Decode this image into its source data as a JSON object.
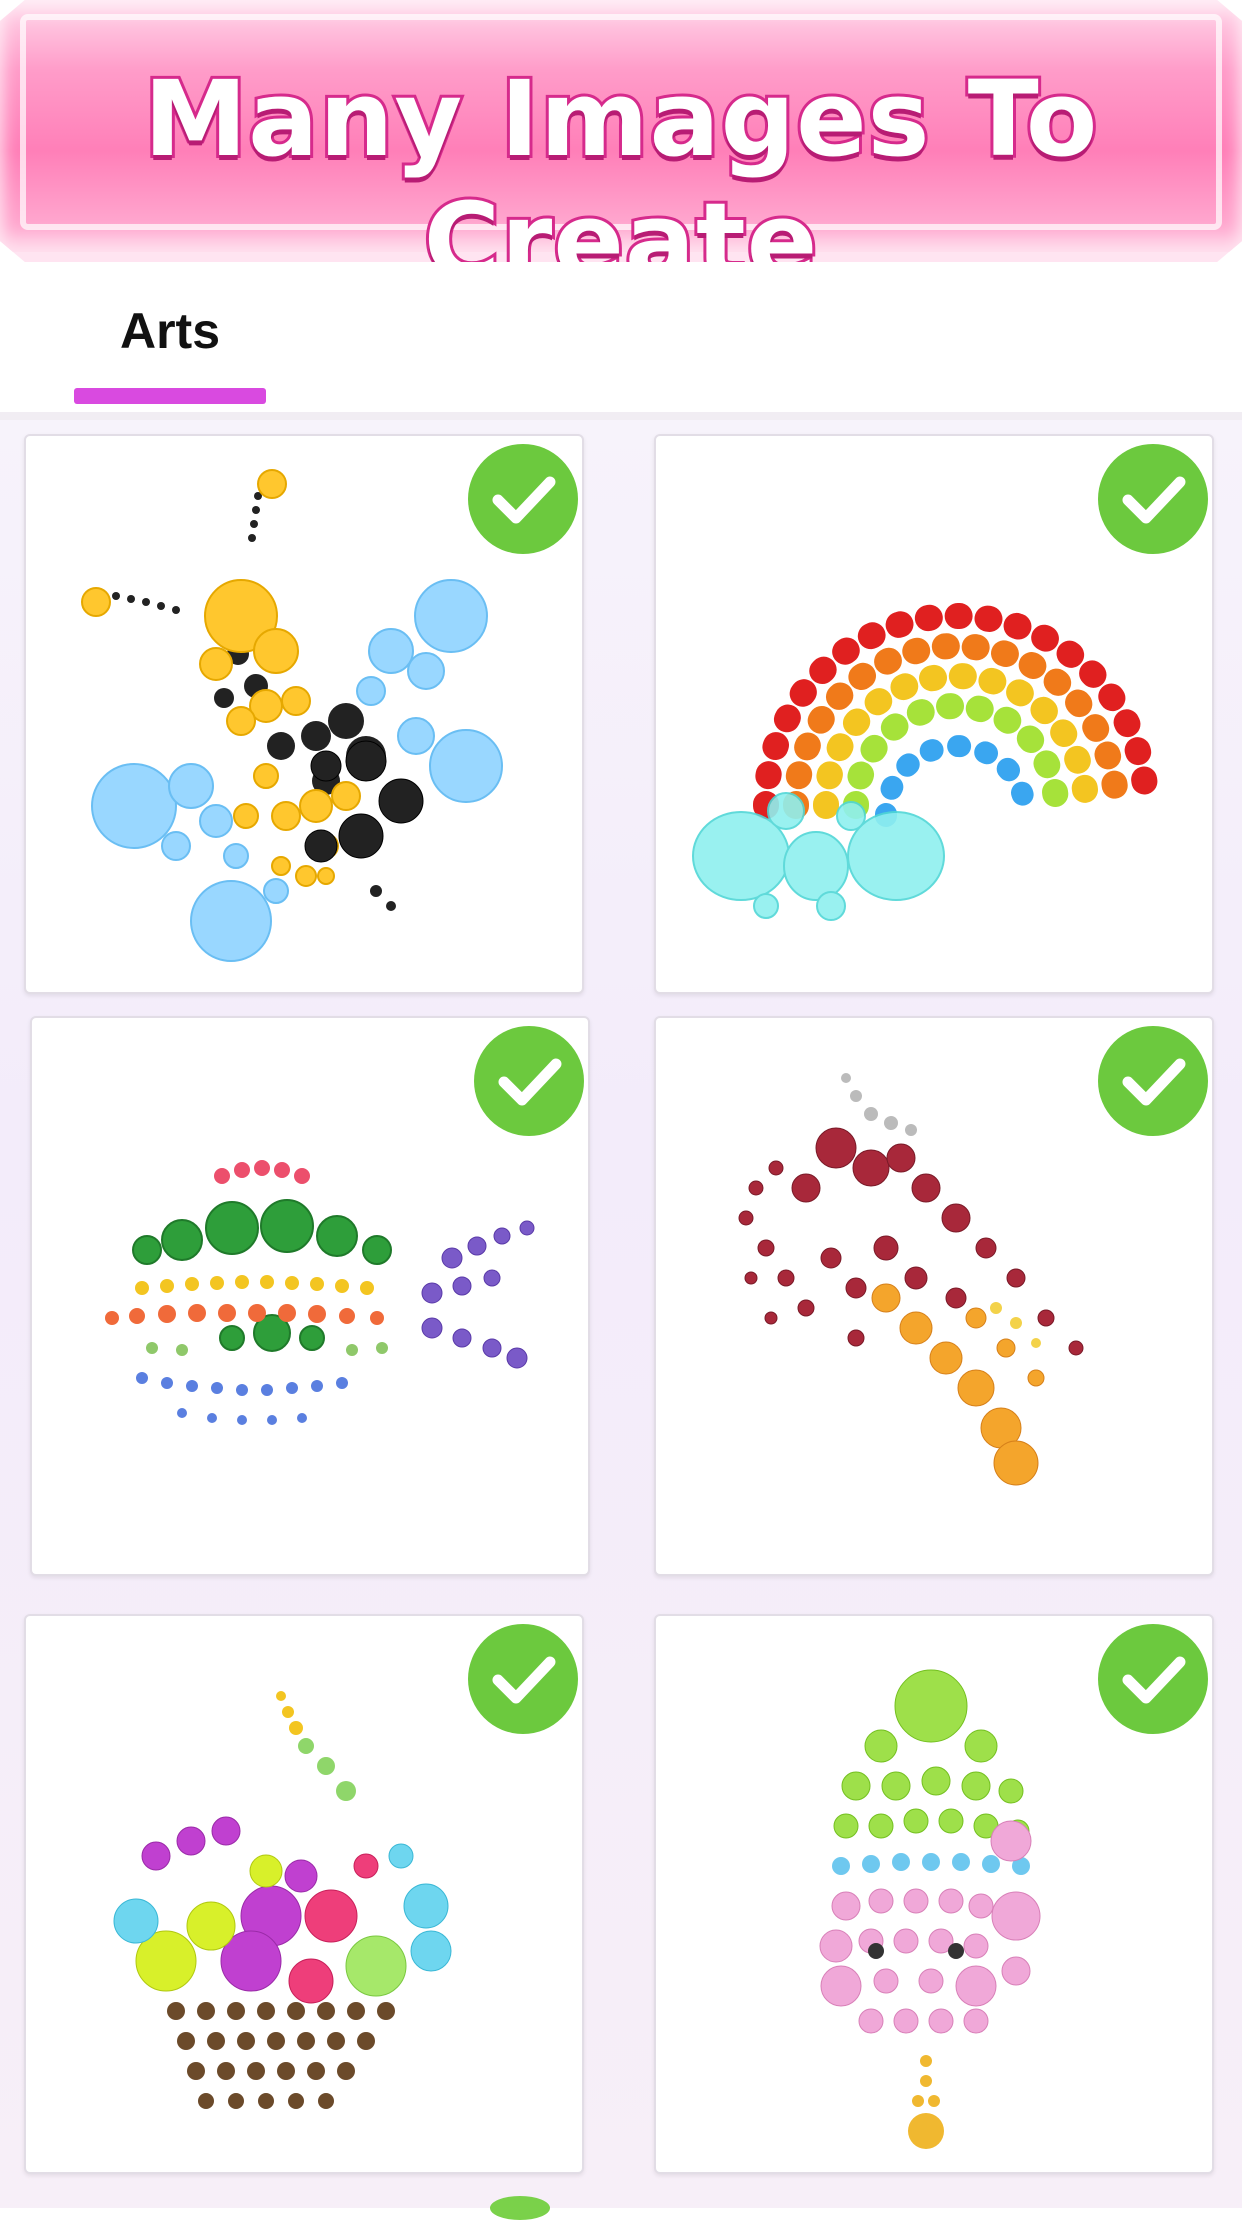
{
  "banner": {
    "title": "Many Images To Create"
  },
  "tabs": [
    {
      "label": "Arts",
      "active": true
    }
  ],
  "colors": {
    "accent": "#d94ae0",
    "check": "#6cc93e",
    "banner_pink": "#ff7fb8",
    "title_stroke": "#d62a8c"
  },
  "gallery": {
    "items": [
      {
        "subject": "bee",
        "completed": true,
        "icon": "check-icon"
      },
      {
        "subject": "rainbow",
        "completed": true,
        "icon": "check-icon"
      },
      {
        "subject": "fish",
        "completed": true,
        "icon": "check-icon"
      },
      {
        "subject": "bird",
        "completed": true,
        "icon": "check-icon"
      },
      {
        "subject": "cupcake",
        "completed": true,
        "icon": "check-icon"
      },
      {
        "subject": "popsicle",
        "completed": true,
        "icon": "check-icon"
      }
    ]
  }
}
